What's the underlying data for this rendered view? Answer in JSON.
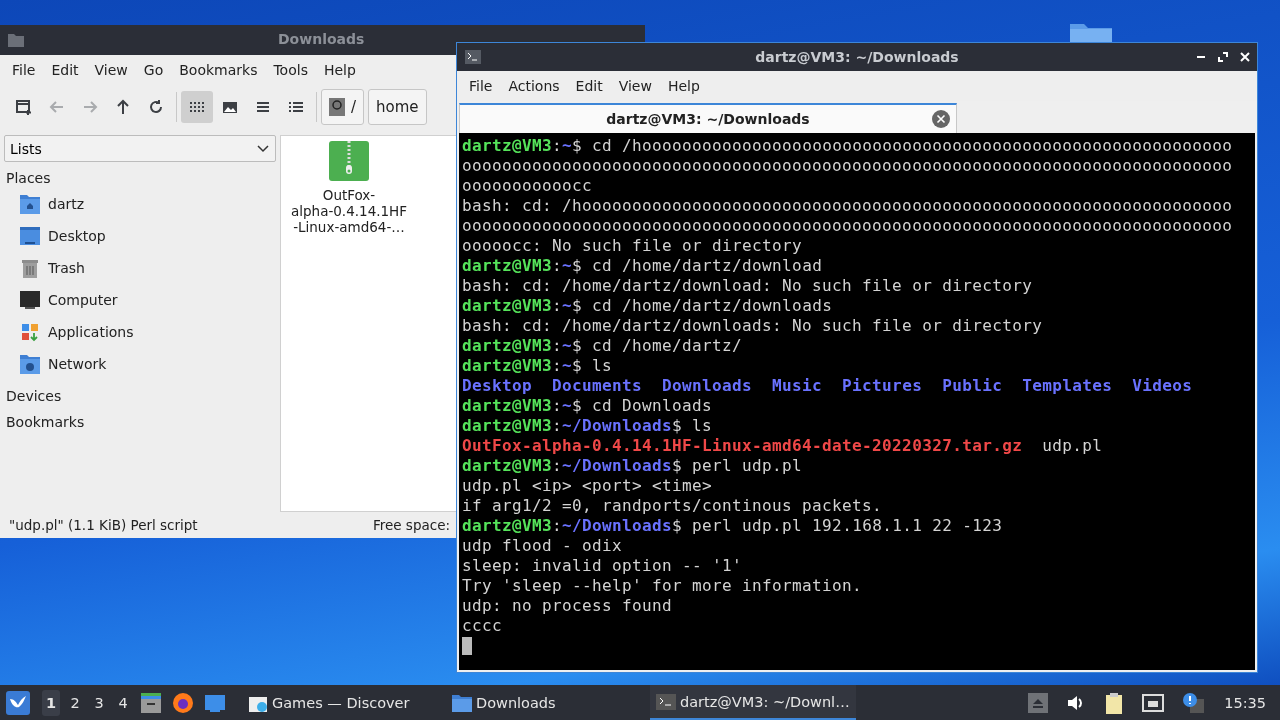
{
  "file_manager": {
    "title": "Downloads",
    "menu": [
      "File",
      "Edit",
      "View",
      "Go",
      "Bookmarks",
      "Tools",
      "Help"
    ],
    "nav_buttons": [
      {
        "kind": "new-tab",
        "disabled": false
      },
      {
        "kind": "back",
        "disabled": true
      },
      {
        "kind": "forward",
        "disabled": true
      },
      {
        "kind": "up",
        "disabled": false
      },
      {
        "kind": "reload",
        "disabled": false
      }
    ],
    "view_modes": [
      {
        "kind": "icons",
        "selected": true
      },
      {
        "kind": "thumbnails",
        "selected": false
      },
      {
        "kind": "compact",
        "selected": false
      },
      {
        "kind": "details",
        "selected": false
      }
    ],
    "path": [
      "/",
      "home"
    ],
    "side_pane": {
      "mode": "Lists",
      "sections": [
        {
          "title": "Places",
          "items": [
            {
              "label": "dartz",
              "kind": "home"
            },
            {
              "label": "Desktop",
              "kind": "desktop"
            },
            {
              "label": "Trash",
              "kind": "trash"
            },
            {
              "label": "Computer",
              "kind": "computer"
            },
            {
              "label": "Applications",
              "kind": "applications"
            },
            {
              "label": "Network",
              "kind": "network"
            }
          ]
        },
        {
          "title": "Devices"
        },
        {
          "title": "Bookmarks"
        }
      ]
    },
    "files": [
      {
        "name_lines": [
          "OutFox-",
          "alpha-0.4.14.1HF",
          "-Linux-amd64-…"
        ],
        "kind": "archive",
        "selected": false
      }
    ],
    "status": "\"udp.pl\" (1.1 KiB) Perl script",
    "free_space": "Free space:"
  },
  "terminal": {
    "title": "dartz@VM3: ~/Downloads",
    "menu": [
      "File",
      "Actions",
      "Edit",
      "View",
      "Help"
    ],
    "tabs": [
      {
        "label": "dartz@VM3: ~/Downloads",
        "selected": true
      }
    ],
    "lines": [
      [
        {
          "text": "dartz@VM3",
          "kind": "user"
        },
        {
          "text": ":",
          "kind": "plain"
        },
        {
          "text": "~",
          "kind": "path"
        },
        {
          "text": "$ cd /hooooooooooooooooooooooooooooooooooooooooooooooooooooooooooo",
          "kind": "plain"
        }
      ],
      [
        {
          "text": "ooooooooooooooooooooooooooooooooooooooooooooooooooooooooooooooooooooooooooooo",
          "kind": "plain"
        }
      ],
      [
        {
          "text": "ooooooooooocc",
          "kind": "plain"
        }
      ],
      [
        {
          "text": "bash: cd: /hooooooooooooooooooooooooooooooooooooooooooooooooooooooooooooooooo",
          "kind": "plain"
        }
      ],
      [
        {
          "text": "ooooooooooooooooooooooooooooooooooooooooooooooooooooooooooooooooooooooooooooo",
          "kind": "plain"
        }
      ],
      [
        {
          "text": "ooooocc: No such file or directory",
          "kind": "plain"
        }
      ],
      [
        {
          "text": "dartz@VM3",
          "kind": "user"
        },
        {
          "text": ":",
          "kind": "plain"
        },
        {
          "text": "~",
          "kind": "path"
        },
        {
          "text": "$ cd /home/dartz/download",
          "kind": "plain"
        }
      ],
      [
        {
          "text": "bash: cd: /home/dartz/download: No such file or directory",
          "kind": "plain"
        }
      ],
      [
        {
          "text": "dartz@VM3",
          "kind": "user"
        },
        {
          "text": ":",
          "kind": "plain"
        },
        {
          "text": "~",
          "kind": "path"
        },
        {
          "text": "$ cd /home/dartz/downloads",
          "kind": "plain"
        }
      ],
      [
        {
          "text": "bash: cd: /home/dartz/downloads: No such file or directory",
          "kind": "plain"
        }
      ],
      [
        {
          "text": "dartz@VM3",
          "kind": "user"
        },
        {
          "text": ":",
          "kind": "plain"
        },
        {
          "text": "~",
          "kind": "path"
        },
        {
          "text": "$ cd /home/dartz/",
          "kind": "plain"
        }
      ],
      [
        {
          "text": "dartz@VM3",
          "kind": "user"
        },
        {
          "text": ":",
          "kind": "plain"
        },
        {
          "text": "~",
          "kind": "path"
        },
        {
          "text": "$ ls",
          "kind": "plain"
        }
      ],
      [
        {
          "text": "Desktop",
          "kind": "dir"
        },
        {
          "text": "Documents",
          "kind": "dir"
        },
        {
          "text": "Downloads",
          "kind": "dir"
        },
        {
          "text": "Music",
          "kind": "dir"
        },
        {
          "text": "Pictures",
          "kind": "dir"
        },
        {
          "text": "Public",
          "kind": "dir"
        },
        {
          "text": "Templates",
          "kind": "dir"
        },
        {
          "text": "Videos",
          "kind": "dir"
        }
      ],
      [
        {
          "text": "dartz@VM3",
          "kind": "user"
        },
        {
          "text": ":",
          "kind": "plain"
        },
        {
          "text": "~",
          "kind": "path"
        },
        {
          "text": "$ cd Downloads",
          "kind": "plain"
        }
      ],
      [
        {
          "text": "dartz@VM3",
          "kind": "user"
        },
        {
          "text": ":",
          "kind": "plain"
        },
        {
          "text": "~/Downloads",
          "kind": "path"
        },
        {
          "text": "$ ls",
          "kind": "plain"
        }
      ],
      [
        {
          "text": "OutFox-alpha-0.4.14.1HF-Linux-amd64-date-20220327.tar.gz",
          "kind": "archive"
        },
        {
          "text": "  udp.pl",
          "kind": "plain"
        }
      ],
      [
        {
          "text": "dartz@VM3",
          "kind": "user"
        },
        {
          "text": ":",
          "kind": "plain"
        },
        {
          "text": "~/Downloads",
          "kind": "path"
        },
        {
          "text": "$ perl udp.pl",
          "kind": "plain"
        }
      ],
      [
        {
          "text": "udp.pl <ip> <port> <time>",
          "kind": "plain"
        }
      ],
      [
        {
          "text": "if arg1/2 =0, randports/continous packets.",
          "kind": "plain"
        }
      ],
      [
        {
          "text": "dartz@VM3",
          "kind": "user"
        },
        {
          "text": ":",
          "kind": "plain"
        },
        {
          "text": "~/Downloads",
          "kind": "path"
        },
        {
          "text": "$ perl udp.pl 192.168.1.1 22 -123",
          "kind": "plain"
        }
      ],
      [
        {
          "text": "udp flood - odix",
          "kind": "plain"
        }
      ],
      [
        {
          "text": "sleep: invalid option -- '1'",
          "kind": "plain"
        }
      ],
      [
        {
          "text": "Try 'sleep --help' for more information.",
          "kind": "plain"
        }
      ],
      [
        {
          "text": "udp: no process found",
          "kind": "plain"
        }
      ],
      [
        {
          "text": "cccc",
          "kind": "plain"
        }
      ]
    ],
    "cursor_visible": true
  },
  "taskbar": {
    "workspaces": [
      {
        "label": "1",
        "selected": true
      },
      {
        "label": "2",
        "selected": false
      },
      {
        "label": "3",
        "selected": false
      },
      {
        "label": "4",
        "selected": false
      }
    ],
    "launchers": [
      {
        "kind": "files"
      },
      {
        "kind": "browser"
      },
      {
        "kind": "desktop"
      }
    ],
    "tasks": [
      {
        "label": "Games — Discover",
        "kind": "discover",
        "selected": false
      },
      {
        "label": "Downloads",
        "kind": "folder",
        "selected": false
      },
      {
        "label": "dartz@VM3: ~/Downl…",
        "kind": "terminal",
        "selected": true
      }
    ],
    "clock": "15:35"
  }
}
